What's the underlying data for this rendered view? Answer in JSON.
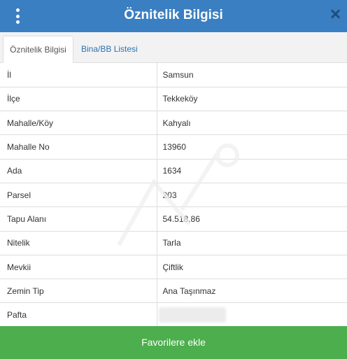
{
  "header": {
    "title": "Öznitelik Bilgisi",
    "menu_icon": "vertical-dots-icon",
    "close_icon": "close-icon"
  },
  "tabs": [
    {
      "label": "Öznitelik Bilgisi",
      "active": true
    },
    {
      "label": "Bina/BB Listesi",
      "active": false
    }
  ],
  "attributes": [
    {
      "key": "İl",
      "value": "Samsun"
    },
    {
      "key": "İlçe",
      "value": "Tekkeköy"
    },
    {
      "key": "Mahalle/Köy",
      "value": "Kahyalı"
    },
    {
      "key": "Mahalle No",
      "value": "13960"
    },
    {
      "key": "Ada",
      "value": "1634"
    },
    {
      "key": "Parsel",
      "value": "203"
    },
    {
      "key": "Tapu Alanı",
      "value": "54.518,86"
    },
    {
      "key": "Nitelik",
      "value": "Tarla"
    },
    {
      "key": "Mevkii",
      "value": "Çiftlik"
    },
    {
      "key": "Zemin Tip",
      "value": "Ana Taşınmaz"
    },
    {
      "key": "Pafta",
      "value": ""
    }
  ],
  "footer": {
    "favorite_label": "Favorilere ekle"
  },
  "colors": {
    "header_bg": "#3a7fc1",
    "button_bg": "#4cae4c",
    "tab_link": "#2a72b5"
  }
}
